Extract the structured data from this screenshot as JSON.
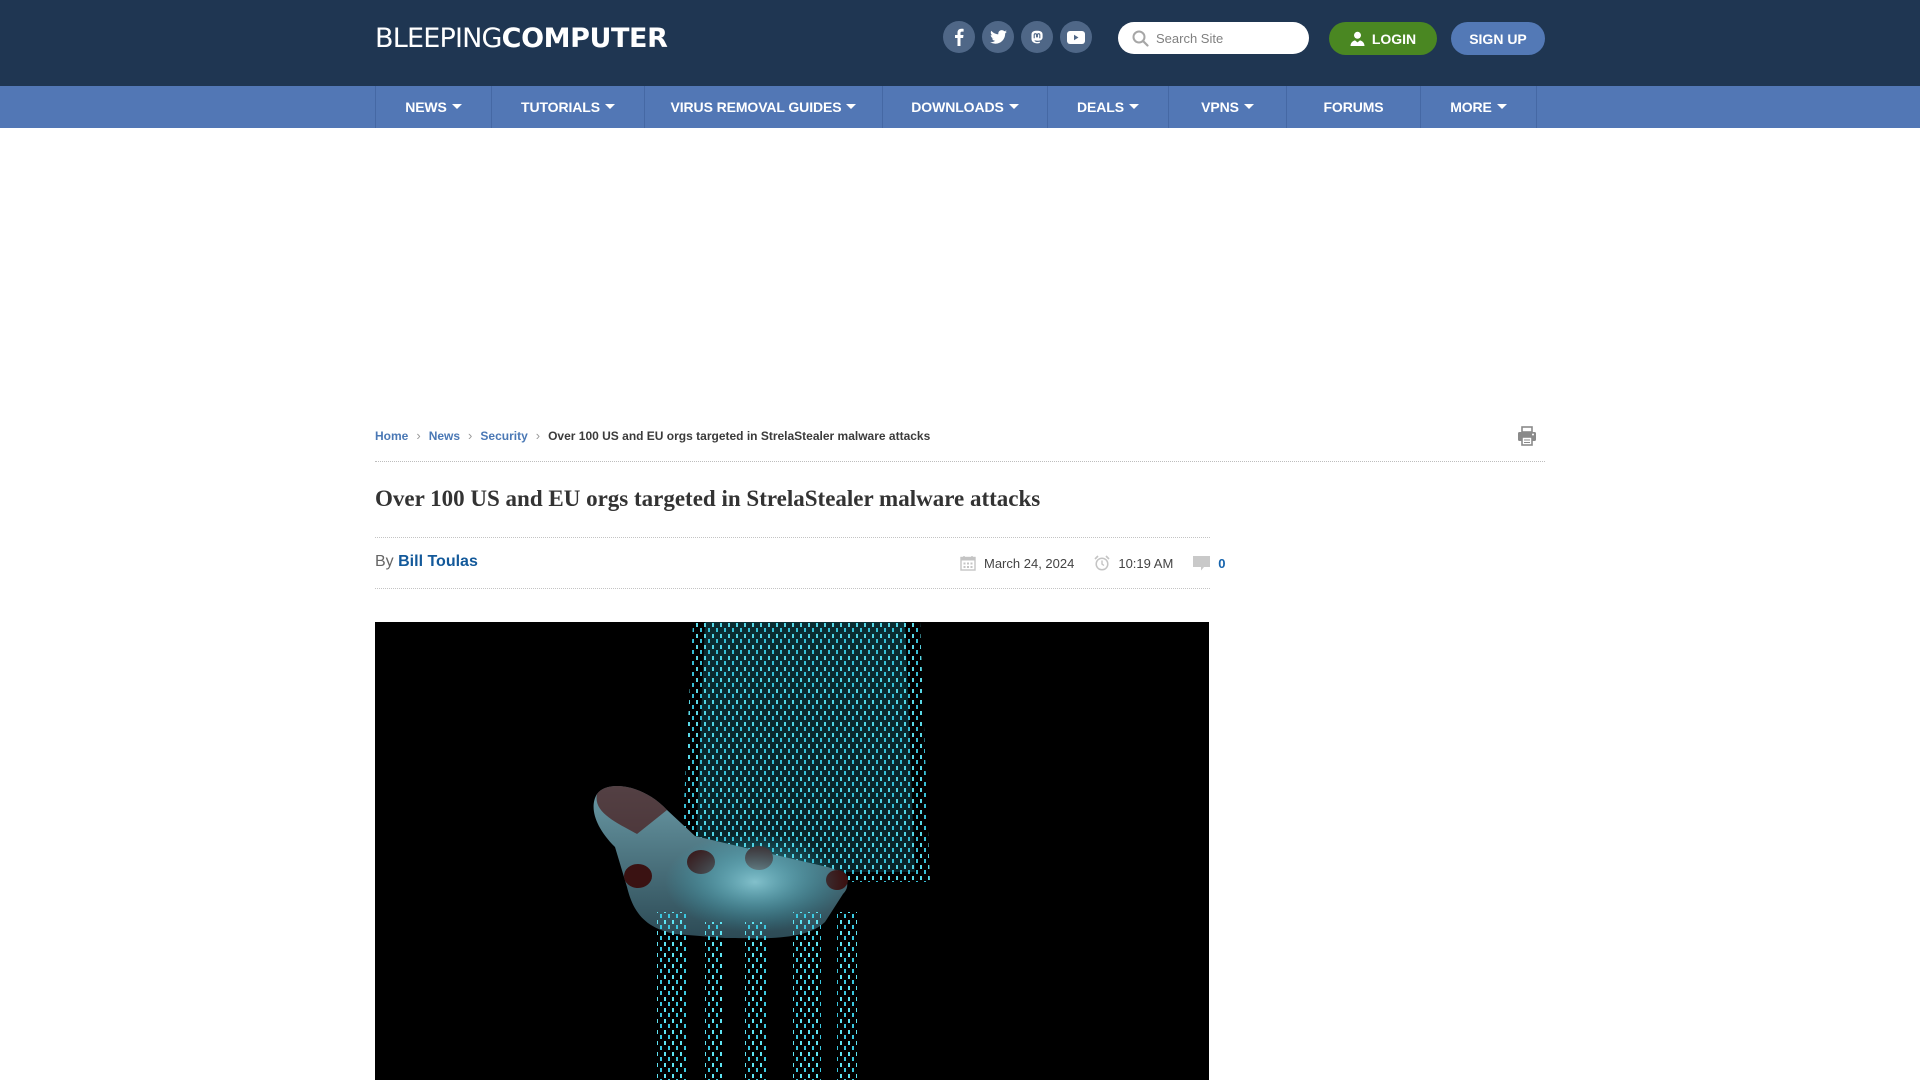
{
  "header": {
    "logo_light": "BLEEPING",
    "logo_bold": "COMPUTER",
    "social": [
      {
        "name": "facebook",
        "icon": "facebook-icon"
      },
      {
        "name": "twitter",
        "icon": "twitter-icon"
      },
      {
        "name": "mastodon",
        "icon": "mastodon-icon"
      },
      {
        "name": "youtube",
        "icon": "youtube-icon"
      }
    ],
    "search_placeholder": "Search Site",
    "search_value": "",
    "login_label": "LOGIN",
    "signup_label": "SIGN UP"
  },
  "nav": {
    "items": [
      {
        "label": "NEWS",
        "dropdown": true
      },
      {
        "label": "TUTORIALS",
        "dropdown": true
      },
      {
        "label": "VIRUS REMOVAL GUIDES",
        "dropdown": true
      },
      {
        "label": "DOWNLOADS",
        "dropdown": true
      },
      {
        "label": "DEALS",
        "dropdown": true
      },
      {
        "label": "VPNS",
        "dropdown": true
      },
      {
        "label": "FORUMS",
        "dropdown": false
      },
      {
        "label": "MORE",
        "dropdown": true
      }
    ]
  },
  "breadcrumb": {
    "items": [
      "Home",
      "News",
      "Security"
    ],
    "current": "Over 100 US and EU orgs targeted in StrelaStealer malware attacks"
  },
  "article": {
    "title": "Over 100 US and EU orgs targeted in StrelaStealer malware attacks",
    "by_label": "By",
    "author": "Bill Toulas",
    "date": "March 24, 2024",
    "time": "10:19 AM",
    "comments": "0",
    "hero_image_alt": "Hand catching falling binary data stream"
  },
  "colors": {
    "header_bg": "#1f3652",
    "nav_bg": "#5277b5",
    "login_green": "#4a8722",
    "signup_blue": "#5379b6",
    "link_blue": "#13599a"
  }
}
